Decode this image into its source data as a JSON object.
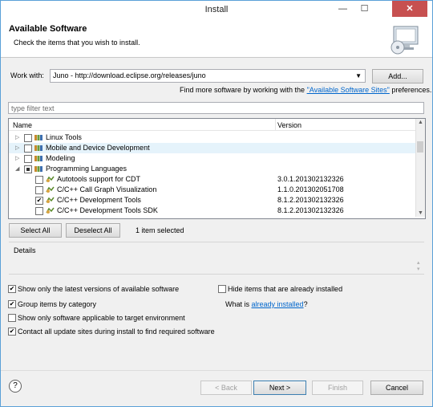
{
  "window": {
    "title": "Install",
    "min": "—",
    "max": "☐",
    "close": "✕"
  },
  "banner": {
    "title": "Available Software",
    "subtitle": "Check the items that you wish to install."
  },
  "work_with": {
    "label": "Work with:",
    "value": "Juno - http://download.eclipse.org/releases/juno",
    "add_button": "Add...",
    "find_more_prefix": "Find more software by working with the ",
    "find_more_link": "\"Available Software Sites\"",
    "find_more_suffix": " preferences."
  },
  "filter": {
    "placeholder": "type filter text"
  },
  "table": {
    "columns": [
      "Name",
      "Version"
    ],
    "rows": [
      {
        "name": "Linux Tools",
        "version": "",
        "level": 0,
        "expander": "▷",
        "check": "none",
        "icon": "group-icon"
      },
      {
        "name": "Mobile and Device Development",
        "version": "",
        "level": 0,
        "expander": "▷",
        "check": "none",
        "icon": "group-icon",
        "highlight": true
      },
      {
        "name": "Modeling",
        "version": "",
        "level": 0,
        "expander": "▷",
        "check": "none",
        "icon": "group-icon"
      },
      {
        "name": "Programming Languages",
        "version": "",
        "level": 0,
        "expander": "◢",
        "check": "partial",
        "icon": "group-icon"
      },
      {
        "name": "Autotools support for CDT",
        "version": "3.0.1.201302132326",
        "level": 1,
        "check": "none",
        "icon": "feature-icon"
      },
      {
        "name": "C/C++ Call Graph Visualization",
        "version": "1.1.0.201302051708",
        "level": 1,
        "check": "none",
        "icon": "feature-icon"
      },
      {
        "name": "C/C++ Development Tools",
        "version": "8.1.2.201302132326",
        "level": 1,
        "check": "checked",
        "icon": "feature-icon"
      },
      {
        "name": "C/C++ Development Tools SDK",
        "version": "8.1.2.201302132326",
        "level": 1,
        "check": "none",
        "icon": "feature-icon"
      }
    ]
  },
  "selection": {
    "select_all": "Select All",
    "deselect_all": "Deselect All",
    "status": "1 item selected"
  },
  "details": {
    "label": "Details"
  },
  "options": {
    "latest_only": {
      "label": "Show only the latest versions of available software",
      "checked": true
    },
    "group_by_category": {
      "label": "Group items by category",
      "checked": true
    },
    "target_env": {
      "label": "Show only software applicable to target environment",
      "checked": false
    },
    "contact_sites": {
      "label": "Contact all update sites during install to find required software",
      "checked": true
    },
    "hide_installed": {
      "label": "Hide items that are already installed",
      "checked": false
    },
    "what_is_prefix": "What is ",
    "what_is_link": "already installed",
    "what_is_suffix": "?"
  },
  "footer": {
    "help": "?",
    "back": "< Back",
    "next": "Next >",
    "finish": "Finish",
    "cancel": "Cancel"
  }
}
